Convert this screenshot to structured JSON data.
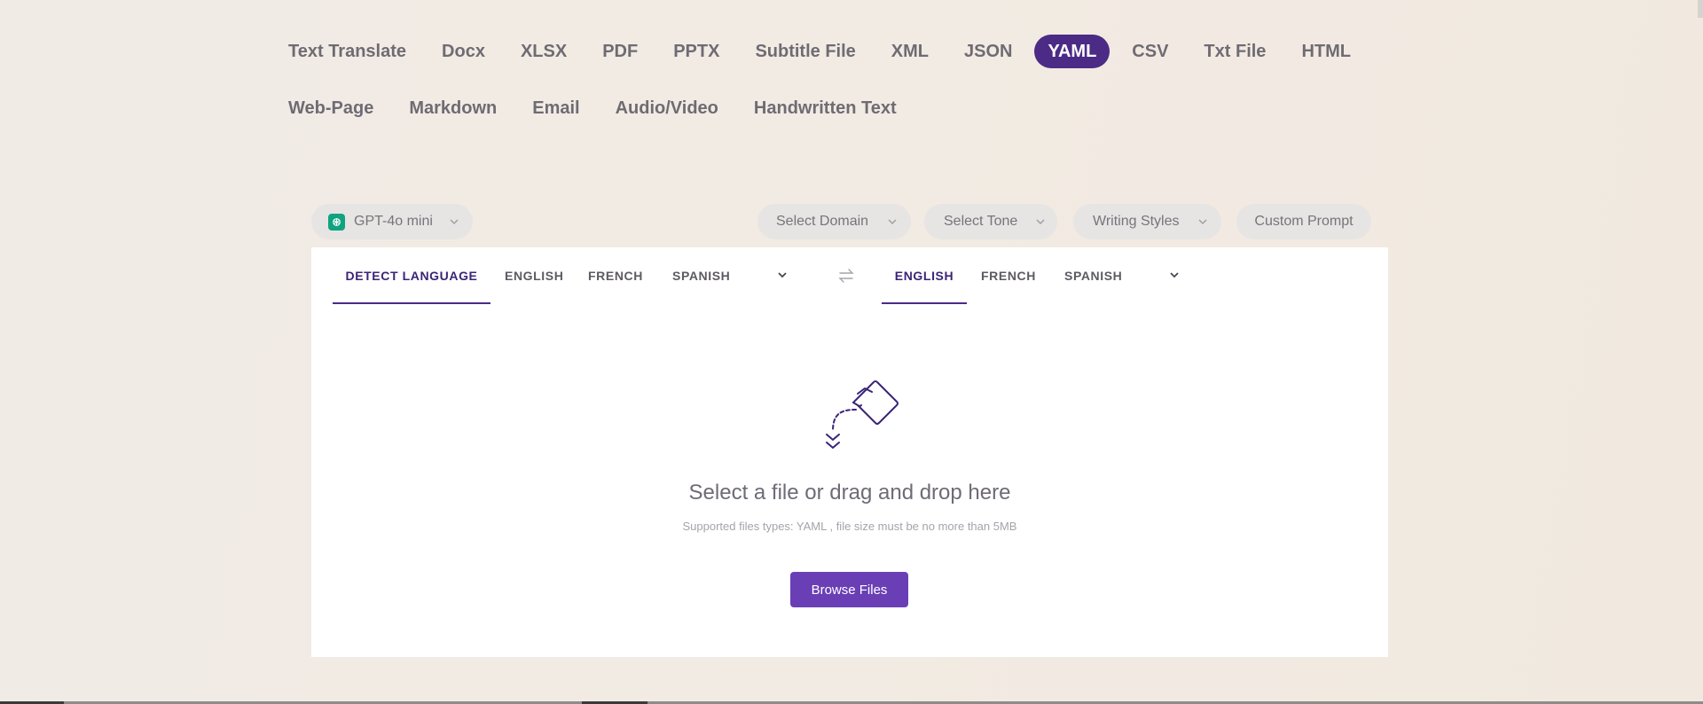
{
  "tabs": {
    "row1": [
      "Text Translate",
      "Docx",
      "XLSX",
      "PDF",
      "PPTX",
      "Subtitle File",
      "XML",
      "JSON",
      "YAML",
      "CSV",
      "Txt File",
      "HTML"
    ],
    "row2": [
      "Web-Page",
      "Markdown",
      "Email",
      "Audio/Video",
      "Handwritten Text"
    ],
    "active": "YAML"
  },
  "options": {
    "model": "GPT-4o mini",
    "domain": "Select Domain",
    "tone": "Select Tone",
    "styles": "Writing Styles",
    "prompt": "Custom Prompt"
  },
  "source_languages": {
    "detect": "DETECT LANGUAGE",
    "english": "ENGLISH",
    "french": "FRENCH",
    "spanish": "SPANISH"
  },
  "target_languages": {
    "english": "ENGLISH",
    "french": "FRENCH",
    "spanish": "SPANISH"
  },
  "dropzone": {
    "title": "Select a file or drag and drop here",
    "subtitle": "Supported files types: YAML , file size must be no more than 5MB",
    "button": "Browse Files"
  },
  "colors": {
    "accent": "#4b2b86",
    "button": "#6a3fb5",
    "model_icon": "#10a37f"
  },
  "icons": {
    "model": "chatgpt-logo-icon",
    "chevron": "chevron-down-icon",
    "swap": "swap-arrows-icon",
    "drop": "file-drop-illustration"
  }
}
